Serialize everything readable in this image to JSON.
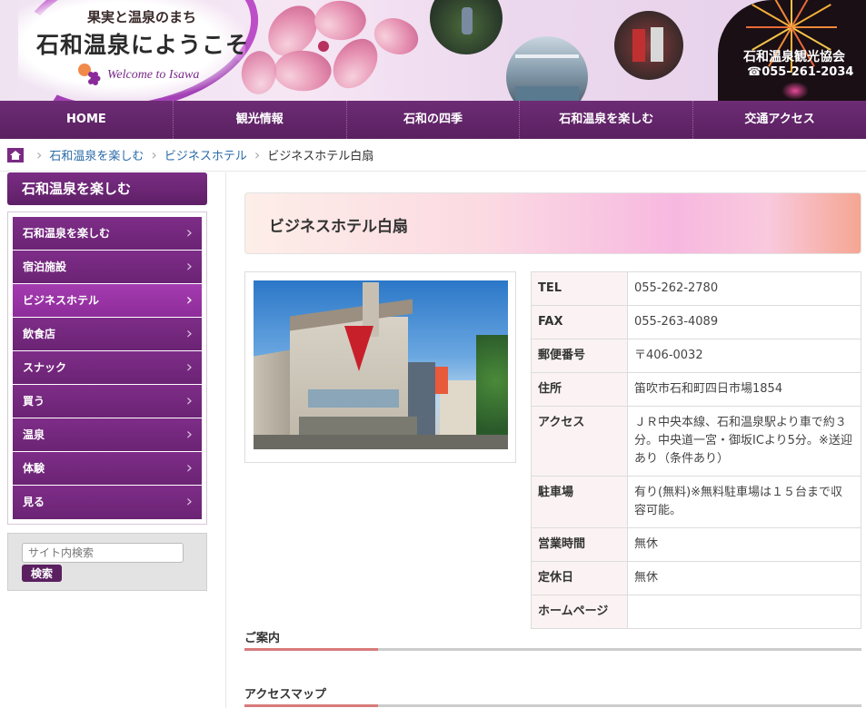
{
  "header": {
    "logo_subtitle": "果実と温泉のまち",
    "logo_title": "石和温泉にようこそ",
    "logo_english": "Welcome to Isawa",
    "association_name": "石和温泉観光協会",
    "association_tel": "☎055-261-2034"
  },
  "nav": {
    "items": [
      "HOME",
      "観光情報",
      "石和の四季",
      "石和温泉を楽しむ",
      "交通アクセス"
    ]
  },
  "breadcrumb": {
    "items": [
      "石和温泉を楽しむ",
      "ビジネスホテル"
    ],
    "current": "ビジネスホテル白扇"
  },
  "sidebar": {
    "title": "石和温泉を楽しむ",
    "items": [
      "石和温泉を楽しむ",
      "宿泊施設",
      "ビジネスホテル",
      "飲食店",
      "スナック",
      "買う",
      "温泉",
      "体験",
      "見る"
    ],
    "active_index": 2,
    "search_placeholder": "サイト内検索",
    "search_button": "検索"
  },
  "main": {
    "title": "ビジネスホテル白扇",
    "info": [
      {
        "key": "TEL",
        "value": "055-262-2780"
      },
      {
        "key": "FAX",
        "value": "055-263-4089"
      },
      {
        "key": "郵便番号",
        "value": "〒406-0032"
      },
      {
        "key": "住所",
        "value": "笛吹市石和町四日市場1854"
      },
      {
        "key": "アクセス",
        "value": "ＪＲ中央本線、石和温泉駅より車で約３分。中央道一宮・御坂ICより5分。※送迎あり（条件あり）"
      },
      {
        "key": "駐車場",
        "value": "有り(無料)※無料駐車場は１５台まで収容可能。"
      },
      {
        "key": "営業時間",
        "value": "無休"
      },
      {
        "key": "定休日",
        "value": "無休"
      },
      {
        "key": "ホームページ",
        "value": ""
      }
    ],
    "section_guide": "ご案内",
    "section_map": "アクセスマップ"
  },
  "colors": {
    "brand_purple": "#6d2c75",
    "active_purple": "#a43cb0",
    "link_blue": "#2a6aa8",
    "section_accent": "#d87a7a"
  }
}
